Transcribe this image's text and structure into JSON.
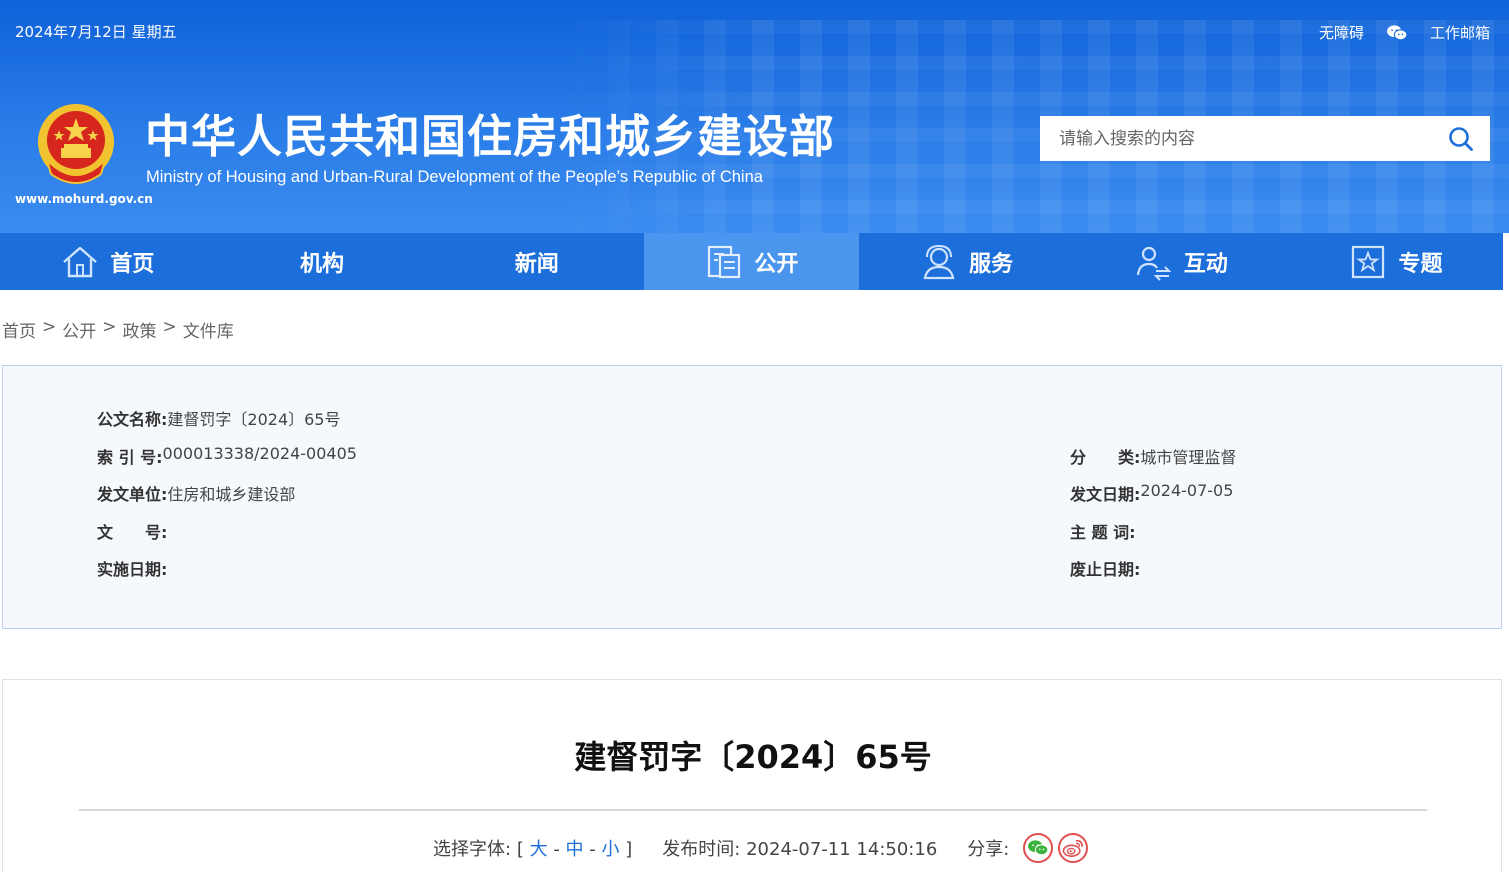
{
  "header": {
    "date": "2024年7月12日 星期五",
    "links": {
      "accessible": "无障碍",
      "mail": "工作邮箱"
    },
    "site_url": "www.mohurd.gov.cn",
    "title": "中华人民共和国住房和城乡建设部",
    "subtitle": "Ministry of Housing and Urban-Rural Development of the People’s Republic of China",
    "search": {
      "placeholder": "请输入搜索的内容"
    }
  },
  "nav": [
    {
      "label": "首页",
      "icon": "home-icon"
    },
    {
      "label": "机构",
      "icon": ""
    },
    {
      "label": "新闻",
      "icon": ""
    },
    {
      "label": "公开",
      "icon": "document-icon",
      "active": true
    },
    {
      "label": "服务",
      "icon": "service-icon"
    },
    {
      "label": "互动",
      "icon": "interaction-icon"
    },
    {
      "label": "专题",
      "icon": "star-icon"
    }
  ],
  "breadcrumb": [
    "首页",
    "公开",
    "政策",
    "文件库"
  ],
  "meta": {
    "doc_name_key": "公文名称:",
    "doc_name_val": "建督罚字〔2024〕65号",
    "index_key": "索 引 号:",
    "index_val": "000013338/2024-00405",
    "category_key": "分　　类:",
    "category_val": "城市管理监督",
    "issuer_key": "发文单位:",
    "issuer_val": "住房和城乡建设部",
    "issue_date_key": "发文日期:",
    "issue_date_val": "2024-07-05",
    "doc_no_key": "文　　号:",
    "doc_no_val": "",
    "subject_key": "主 题 词:",
    "subject_val": "",
    "effective_key": "实施日期:",
    "effective_val": "",
    "expire_key": "废止日期:",
    "expire_val": ""
  },
  "article": {
    "title": "建督罚字〔2024〕65号",
    "font_label": "选择字体:",
    "font_open": "[",
    "font_large": "大",
    "font_medium": "中",
    "font_small": "小",
    "font_close": "]",
    "font_dash": "-",
    "pub_label": "发布时间:",
    "pub_time": "2024-07-11 14:50:16",
    "share_label": "分享:"
  },
  "colors": {
    "nav_bg": "#1c6fdb",
    "nav_active": "#4a95ee",
    "header_bg": "#1a6fe0",
    "link": "#1c6fdb"
  }
}
